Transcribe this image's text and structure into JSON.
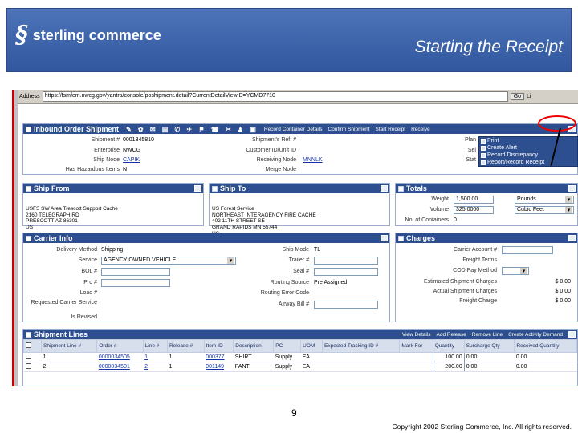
{
  "banner": {
    "logo_text": "sterling commerce",
    "title": "Starting the Receipt"
  },
  "browser": {
    "address_label": "Address",
    "url": "https://fsmfem.nwcg.gov/yantra/console/poshipment.detail?CurrentDetailViewID=YCMD7710",
    "go_label": "Go",
    "links_label": "Li"
  },
  "inbound": {
    "title": "Inbound Order Shipment",
    "actions": [
      "Record Container Details",
      "Confirm Shipment",
      "Start Receipt",
      "Receive"
    ],
    "labels": {
      "shipment": "Shipment #",
      "enterprise": "Enterprise",
      "ship_node": "Ship Node",
      "hazardous": "Has Hazardous Items",
      "ref": "Shipment's Ref. #",
      "customer": "Customer ID/Unit ID",
      "receiving": "Receiving Node",
      "merge": "Merge Node",
      "plan": "Plan",
      "sel": "Sel",
      "stat": "Stat"
    },
    "values": {
      "shipment": "0001345810",
      "enterprise": "NWCG",
      "ship_node": "CAPIK",
      "hazardous": "N",
      "receiving": "MNNLK"
    }
  },
  "menu": {
    "items": [
      "Print",
      "Create Alert",
      "Record Discrepancy",
      "Report/Record Receipt"
    ]
  },
  "ship_from": {
    "title": "Ship From",
    "lines": [
      "USFS SW Area Trescott Support Cache",
      "2160 TELEGRAPH RD",
      "PRESCOTT AZ 86301",
      "US"
    ]
  },
  "ship_to": {
    "title": "Ship To",
    "lines": [
      "US Forest Service",
      "NORTHEAST INTERAGENCY FIRE CACHE",
      "402 11TH STREET SE",
      "GRAND RAPIDS MN 55744",
      "US"
    ]
  },
  "totals": {
    "title": "Totals",
    "weight_label": "Weight",
    "weight": "1,500.00",
    "weight_unit": "Pounds",
    "volume_label": "Volume",
    "volume": "325.0000",
    "volume_unit": "Cubic Feet",
    "containers_label": "No. of Containers",
    "containers": "0"
  },
  "carrier": {
    "title": "Carrier Info",
    "delivery_label": "Delivery Method",
    "delivery": "Shipping",
    "service_label": "Service",
    "service": "AGENCY OWNED VEHICLE",
    "bol_label": "BOL #",
    "pro_label": "Pro #",
    "load_label": "Load #",
    "req_label": "Requested Carrier Service",
    "revised_label": "Is Revised",
    "mode_label": "Ship Mode",
    "mode": "TL",
    "trailer_label": "Trailer #",
    "seal_label": "Seal #",
    "routing_label": "Routing Source",
    "routing": "Pre Assigned",
    "error_label": "Routing Error Code",
    "airway_label": "Airway Bill #"
  },
  "charges": {
    "title": "Charges",
    "account_label": "Carrier Account #",
    "terms_label": "Freight Terms",
    "cod_label": "COD Pay Method",
    "est_label": "Estimated Shipment Charges",
    "est": "$ 0.00",
    "actual_label": "Actual Shipment Charges",
    "actual": "$ 0.00",
    "freight_label": "Freight Charge",
    "freight": "$ 0.00"
  },
  "lines": {
    "title": "Shipment Lines",
    "actions": [
      "View Details",
      "Add Release",
      "Remove Line",
      "Create Activity Demand"
    ],
    "headers": [
      "Shipment Line #",
      "Order #",
      "Line #",
      "Release #",
      "Item ID",
      "Description",
      "PC",
      "UOM",
      "Expected Tracking ID #",
      "Mark For",
      "Quantity",
      "Surcharge Qty",
      "Received Quantity"
    ],
    "rows": [
      [
        "1",
        "0000034505",
        "1",
        "1",
        "000377",
        "SHIRT",
        "Supply",
        "EA",
        "",
        "",
        "100.00",
        "0.00",
        "0.00"
      ],
      [
        "2",
        "0000034501",
        "2",
        "1",
        "001149",
        "PANT",
        "Supply",
        "EA",
        "",
        "",
        "200.00",
        "0.00",
        "0.00"
      ]
    ]
  },
  "footer": {
    "page": "9",
    "copyright": "Copyright 2002 Sterling Commerce, Inc. All rights reserved."
  }
}
